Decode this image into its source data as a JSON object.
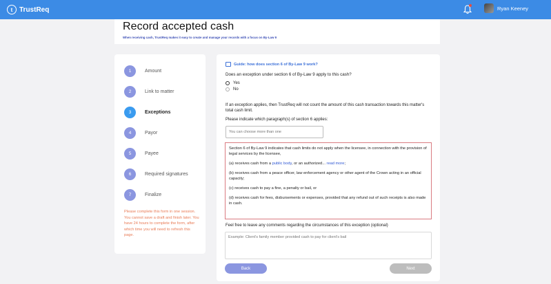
{
  "app": {
    "name": "TrustReq",
    "logo_letter": "t"
  },
  "user": {
    "name": "Ryan Keeney"
  },
  "page": {
    "title": "Record accepted cash",
    "subtitle": "When receiving cash, TrustReq makes it easy to create and manage your records with a focus on By-Law 9"
  },
  "steps": [
    {
      "number": "1",
      "label": "Amount"
    },
    {
      "number": "2",
      "label": "Link to matter"
    },
    {
      "number": "3",
      "label": "Exceptions"
    },
    {
      "number": "4",
      "label": "Payor"
    },
    {
      "number": "5",
      "label": "Payee"
    },
    {
      "number": "6",
      "label": "Required signatures"
    },
    {
      "number": "7",
      "label": "Finalize"
    }
  ],
  "active_step": 3,
  "notice": "Please complete this form in one session. You cannot save a draft and finish later. You have 24 hours to complete the form, after which time you will need to refresh this page.",
  "form": {
    "guide": "Guide: how does section 6 of By-Law 9 work?",
    "question": "Does an exception under section 6 of By-Law 9 apply to this cash?",
    "options": [
      "Yes",
      "No"
    ],
    "selected_option": "Yes",
    "info": "If an exception applies, then TrustReq will not count the amount of this cash transaction towards this matter's total cash limit.",
    "paragraph_question": "Please indicate which paragraph(s) of section 6 applies:",
    "paragraph_placeholder": "You can choose more than one",
    "section_text": {
      "intro": "Section 6 of By-Law 9 indicates that cash limits do not apply when the licensee, in connection with the provision of legal services by the licensee,",
      "a_prefix": "(a) receives cash from a ",
      "a_link": "public body",
      "a_middle": ", or an authorized... ",
      "a_more": "read more",
      "a_suffix": ";",
      "b": "(b) receives cash from a peace officer, law enforcement agency or other agent of the Crown acting in an official capacity;",
      "c": "(c) receives cash to pay a fine, a penalty or bail, or",
      "d": "(d) receives cash for fees, disbursements or expenses, provided that any refund out of such receipts is also made in cash."
    },
    "comments_label": "Feel free to leave any comments regarding the circumstances of this exception (optional)",
    "comments_placeholder": "Example: Client's family member provided cash to pay for client's bail",
    "back_label": "Back",
    "next_label": "Next"
  },
  "colors": {
    "topbar": "#3c8be5",
    "step": "#8b96e0",
    "step_active": "#3a9bef",
    "notice": "#e87a55",
    "section_border": "#d97a80",
    "next_disabled": "#bdbdbd"
  }
}
